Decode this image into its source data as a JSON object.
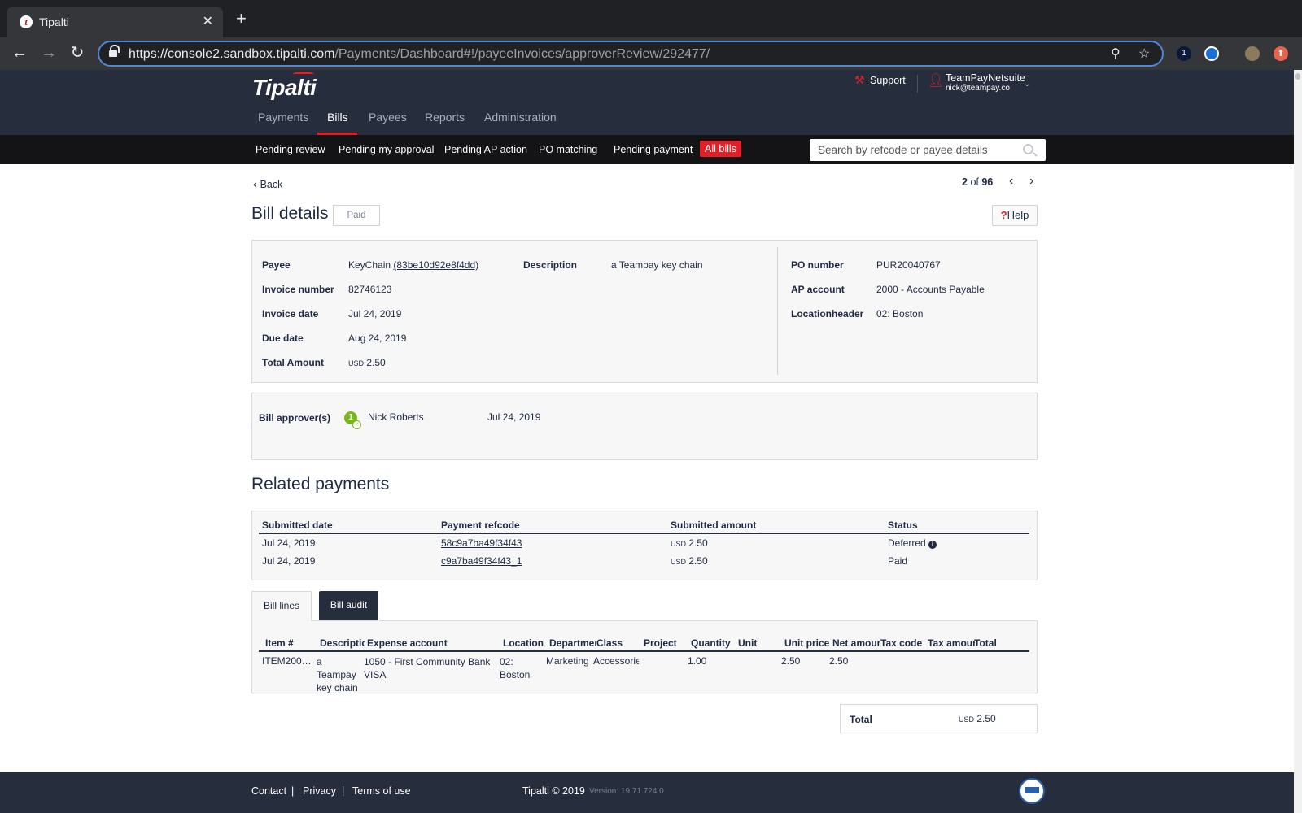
{
  "browser": {
    "tab_title": "Tipalti",
    "favicon_letter": "t",
    "close_glyph": "✕",
    "newtab_glyph": "+",
    "url_host": "https://console2.sandbox.tipalti.com",
    "url_path": "/Payments/Dashboard#!/payeeInvoices/approverReview/292477/",
    "ext1_label": "1",
    "ext4_label": "⬆"
  },
  "header": {
    "logo": "Tipalti",
    "support_label": "Support",
    "user_name": "TeamPayNetsuite",
    "user_email": "nick@teampay.co",
    "main_nav": [
      "Payments",
      "Bills",
      "Payees",
      "Reports",
      "Administration"
    ],
    "active_main": "Bills",
    "sub_nav": [
      "Pending review",
      "Pending my approval",
      "Pending AP action",
      "PO matching",
      "Pending payment",
      "All bills"
    ],
    "active_sub": "All bills",
    "search_placeholder": "Search by refcode or payee details"
  },
  "page": {
    "back_label": "Back",
    "pager_current": "2",
    "pager_of": "of",
    "pager_total": "96",
    "title": "Bill details",
    "status": "Paid",
    "help_q": "?",
    "help_label": "Help"
  },
  "details": {
    "payee_label": "Payee",
    "payee_name": "KeyChain",
    "payee_id": "(83be10d92e8f4dd)",
    "invoice_number_label": "Invoice number",
    "invoice_number": "82746123",
    "invoice_date_label": "Invoice date",
    "invoice_date": "Jul 24, 2019",
    "due_date_label": "Due date",
    "due_date": "Aug 24, 2019",
    "total_amount_label": "Total Amount",
    "total_currency": "USD",
    "total_amount": "2.50",
    "description_label": "Description",
    "description": "a Teampay key chain",
    "po_number_label": "PO number",
    "po_number": "PUR20040767",
    "ap_account_label": "AP account",
    "ap_account": "2000 - Accounts Payable",
    "location_label": "Locationheader",
    "location": "02: Boston"
  },
  "approvers": {
    "label": "Bill approver(s)",
    "step": "1",
    "check": "✓",
    "name": "Nick Roberts",
    "date": "Jul 24, 2019"
  },
  "related_payments": {
    "title": "Related payments",
    "headers": [
      "Submitted date",
      "Payment refcode",
      "Submitted amount",
      "Status"
    ],
    "rows": [
      {
        "date": "Jul 24, 2019",
        "refcode": "58c9a7ba49f34f43",
        "currency": "USD",
        "amount": "2.50",
        "status": "Deferred",
        "info": "i"
      },
      {
        "date": "Jul 24, 2019",
        "refcode": "c9a7ba49f34f43_1",
        "currency": "USD",
        "amount": "2.50",
        "status": "Paid",
        "info": ""
      }
    ]
  },
  "bill_tabs": {
    "lines_label": "Bill lines",
    "audit_label": "Bill audit"
  },
  "bill_lines": {
    "headers": [
      "Item #",
      "Description",
      "Expense account",
      "Location",
      "Department",
      "Class",
      "Project",
      "Quantity",
      "Unit",
      "Unit price",
      "Net amount",
      "Tax code",
      "Tax amount",
      "Total"
    ],
    "row": {
      "item": "ITEM200…",
      "description": "a Teampay key chain",
      "expense_account": "1050 - First Community Bank VISA",
      "location": "02: Boston",
      "department": "Marketing",
      "class": "Accessories",
      "project": "",
      "quantity": "1.00",
      "unit": "",
      "unit_price": "2.50",
      "net_amount": "2.50",
      "tax_code": "",
      "tax_amount": "",
      "total": ""
    }
  },
  "totals": {
    "label": "Total",
    "currency": "USD",
    "amount": "2.50"
  },
  "footer": {
    "contact": "Contact",
    "privacy": "Privacy",
    "terms": "Terms of use",
    "separator": "|",
    "copyright": "Tipalti © 2019",
    "version": "Version: 19.71.724.0"
  }
}
